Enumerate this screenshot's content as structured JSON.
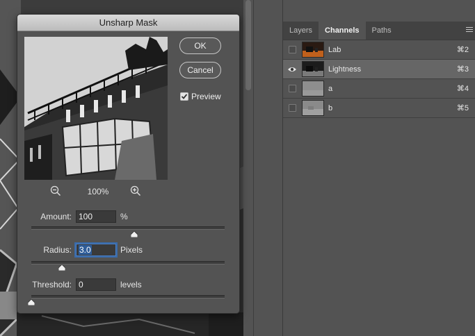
{
  "dialog": {
    "title": "Unsharp Mask",
    "ok_label": "OK",
    "cancel_label": "Cancel",
    "preview_label": "Preview",
    "preview_checked": true,
    "zoom_level": "100%",
    "amount": {
      "label": "Amount:",
      "value": "100",
      "unit": "%",
      "slider_fraction": 0.533
    },
    "radius": {
      "label": "Radius:",
      "value": "3.0",
      "unit": "Pixels",
      "slider_fraction": 0.16
    },
    "threshold": {
      "label": "Threshold:",
      "value": "0",
      "unit": "levels",
      "slider_fraction": 0.0
    }
  },
  "panel": {
    "tabs": [
      {
        "label": "Layers",
        "active": false
      },
      {
        "label": "Channels",
        "active": true
      },
      {
        "label": "Paths",
        "active": false
      }
    ],
    "channels": [
      {
        "name": "Lab",
        "shortcut": "⌘2",
        "visible": false,
        "selected": false
      },
      {
        "name": "Lightness",
        "shortcut": "⌘3",
        "visible": true,
        "selected": true
      },
      {
        "name": "a",
        "shortcut": "⌘4",
        "visible": false,
        "selected": false
      },
      {
        "name": "b",
        "shortcut": "⌘5",
        "visible": false,
        "selected": false
      }
    ]
  },
  "colors": {
    "panel_bg": "#535353",
    "selected_row": "#666666",
    "focus_blue": "#3a6aa8"
  }
}
